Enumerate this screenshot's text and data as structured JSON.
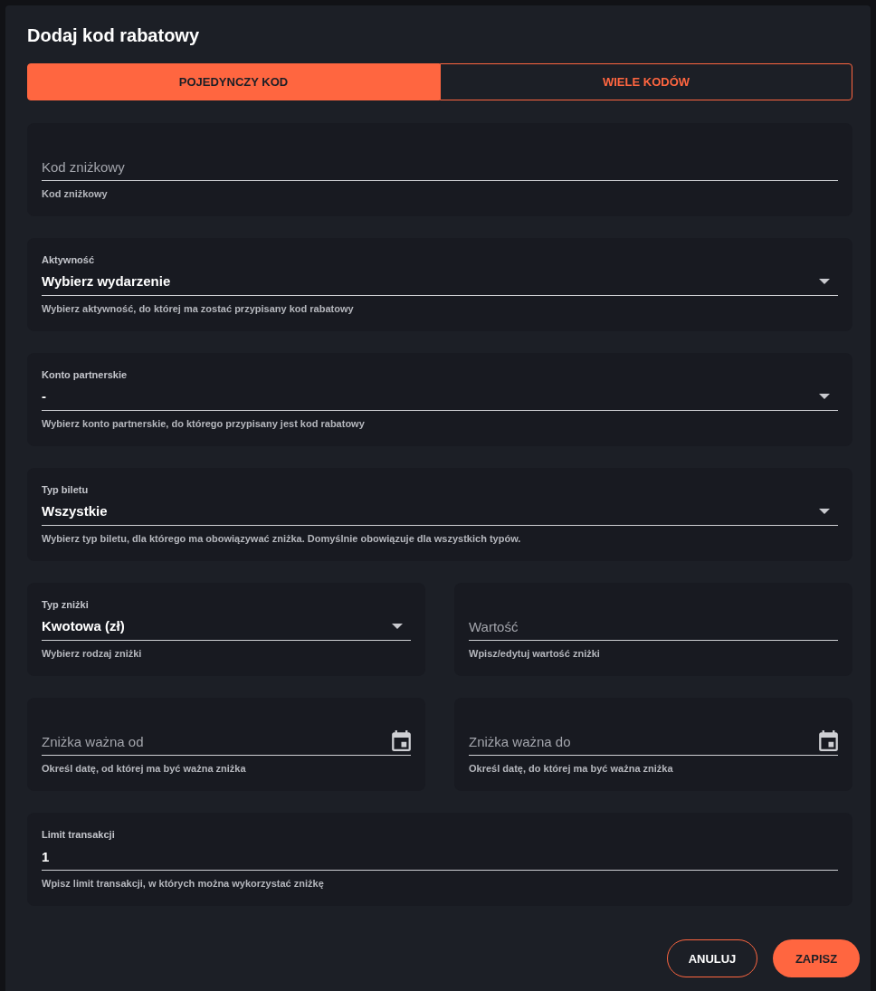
{
  "dialog": {
    "title": "Dodaj kod rabatowy"
  },
  "tabs": [
    {
      "label": "POJEDYNCZY KOD",
      "selected": true
    },
    {
      "label": "WIELE KODÓW",
      "selected": false
    }
  ],
  "rows": [
    [
      {
        "kind": "input",
        "placeholder": "Kod zniżkowy",
        "helper": "Kod zniżkowy"
      }
    ],
    [
      {
        "kind": "select",
        "label": "Aktywność",
        "value": "Wybierz wydarzenie",
        "helper": "Wybierz aktywność, do której ma zostać przypisany kod rabatowy"
      }
    ],
    [
      {
        "kind": "select",
        "label": "Konto partnerskie",
        "value": "-",
        "helper": "Wybierz konto partnerskie, do którego przypisany jest kod rabatowy"
      }
    ],
    [
      {
        "kind": "select",
        "label": "Typ biletu",
        "value": "Wszystkie",
        "helper": "Wybierz typ biletu, dla którego ma obowiązywać zniżka. Domyślnie obowiązuje dla wszystkich typów."
      }
    ],
    [
      {
        "kind": "select",
        "label": "Typ zniżki",
        "value": "Kwotowa (zł)",
        "helper": "Wybierz rodzaj zniżki"
      },
      {
        "kind": "input",
        "placeholder": "Wartość",
        "helper": "Wpisz/edytuj wartość zniżki"
      }
    ],
    [
      {
        "kind": "date",
        "placeholder": "Zniżka ważna od",
        "helper": "Określ datę, od której ma być ważna zniżka"
      },
      {
        "kind": "date",
        "placeholder": "Zniżka ważna do",
        "helper": "Określ datę, do której ma być ważna zniżka"
      }
    ],
    [
      {
        "kind": "input",
        "label": "Limit transakcji",
        "value": "1",
        "helper": "Wpisz limit transakcji, w których można wykorzystać zniżkę"
      }
    ]
  ],
  "buttons": [
    {
      "label": "ANULUJ",
      "kind": "outline"
    },
    {
      "label": "ZAPISZ",
      "kind": "filled"
    }
  ]
}
